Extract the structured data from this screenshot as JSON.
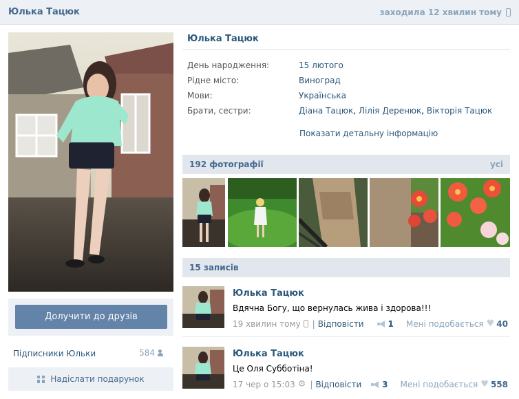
{
  "topbar": {
    "name": "Юлька Тацюк",
    "last_seen": "заходила 12 хвилин тому"
  },
  "profile": {
    "name": "Юлька Тацюк",
    "info": [
      {
        "key": "День народження:",
        "value": "15 лютого"
      },
      {
        "key": "Рідне місто:",
        "value": "Виноград"
      },
      {
        "key": "Мови:",
        "value": "Українська"
      },
      {
        "key": "Брати, сестри:",
        "siblings": [
          "Діана Тацюк",
          "Лілія Деренюк",
          "Вікторія Тацюк"
        ]
      }
    ],
    "more_link": "Показати детальну інформацію"
  },
  "left": {
    "add_friend": "Долучити до друзів",
    "subscribers_label": "Підписники Юльки",
    "subscribers_count": "584",
    "gift_label": "Надіслати подарунок"
  },
  "photos": {
    "header": "192 фотографії",
    "all": "усі"
  },
  "posts_section": {
    "header": "15 записів"
  },
  "posts": [
    {
      "author": "Юлька Тацюк",
      "text": "Вдячна Богу, що вернулась жива і здорова!!!",
      "time": "19 хвилин тому",
      "reply": "Відповісти",
      "shares": "1",
      "likes_label": "Мені подобається",
      "likes": "40"
    },
    {
      "author": "Юлька Тацюк",
      "text": "Це Оля Субботіна!",
      "time": "17 чер о 15:03",
      "reply": "Відповісти",
      "shares": "3",
      "likes_label": "Мені подобається",
      "likes": "558"
    }
  ],
  "icons": {
    "topbar_device": "mobile-phone-icon",
    "subscribers": "users-icon",
    "gift": "gift-icon",
    "share": "megaphone-icon",
    "like": "heart-icon",
    "post1_device": "mobile-phone-icon",
    "post2_device": "gear-icon"
  },
  "colors": {
    "link": "#2b587a",
    "header_bg": "#edf1f5",
    "section_bg": "#e1e7ed",
    "button": "#6383a8"
  }
}
